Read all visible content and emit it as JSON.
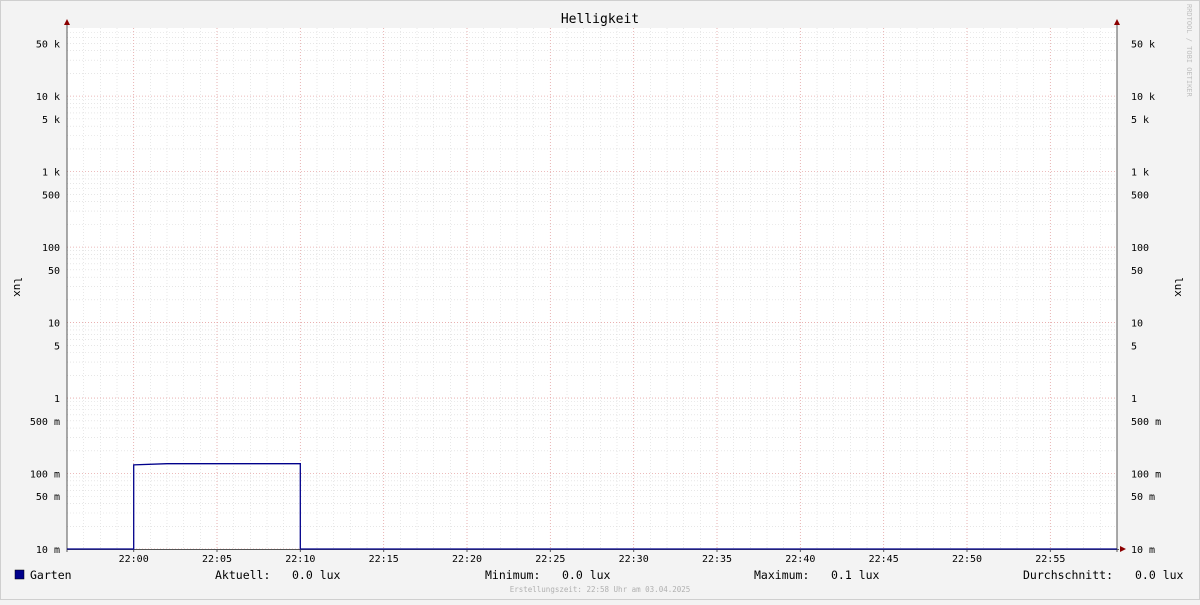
{
  "chart_data": {
    "type": "line",
    "title": "Helligkeit",
    "ylabel": "lux",
    "ylabel_right": "lux",
    "yscale": "log",
    "ylim": [
      0.01,
      80000
    ],
    "xlim_minutes": [
      "21:56",
      "22:59"
    ],
    "x_ticks": [
      "22:00",
      "22:05",
      "22:10",
      "22:15",
      "22:20",
      "22:25",
      "22:30",
      "22:35",
      "22:40",
      "22:45",
      "22:50",
      "22:55"
    ],
    "y_ticks": [
      {
        "value": 50000,
        "label": "50 k"
      },
      {
        "value": 10000,
        "label": "10 k"
      },
      {
        "value": 5000,
        "label": "5 k"
      },
      {
        "value": 1000,
        "label": "1 k"
      },
      {
        "value": 500,
        "label": "500"
      },
      {
        "value": 100,
        "label": "100"
      },
      {
        "value": 50,
        "label": "50"
      },
      {
        "value": 10,
        "label": "10"
      },
      {
        "value": 5,
        "label": "5"
      },
      {
        "value": 1,
        "label": "1"
      },
      {
        "value": 0.5,
        "label": "500 m"
      },
      {
        "value": 0.1,
        "label": "100 m"
      },
      {
        "value": 0.05,
        "label": "50 m"
      },
      {
        "value": 0.01,
        "label": "10 m"
      }
    ],
    "grid": true,
    "series": [
      {
        "name": "Garten",
        "color": "#00008b",
        "step": true,
        "points": [
          {
            "x": "21:56",
            "y": 0.01
          },
          {
            "x": "22:00",
            "y": 0.01
          },
          {
            "x": "22:00",
            "y": 0.13
          },
          {
            "x": "22:02",
            "y": 0.135
          },
          {
            "x": "22:10",
            "y": 0.135
          },
          {
            "x": "22:10",
            "y": 0.01
          },
          {
            "x": "22:59",
            "y": 0.01
          }
        ]
      }
    ],
    "legend": {
      "position": "bottom",
      "series_label": "Garten",
      "series_color": "#00008b",
      "stats": [
        {
          "label": "Aktuell:",
          "value": "0.0 lux"
        },
        {
          "label": "Minimum:",
          "value": "0.0 lux"
        },
        {
          "label": "Maximum:",
          "value": "0.1 lux"
        },
        {
          "label": "Durchschnitt:",
          "value": "0.0 lux"
        }
      ]
    },
    "footer": "Erstellungszeit: 22:58 Uhr am 03.04.2025",
    "watermark": "RRDTOOL / TOBI OETIKER"
  }
}
